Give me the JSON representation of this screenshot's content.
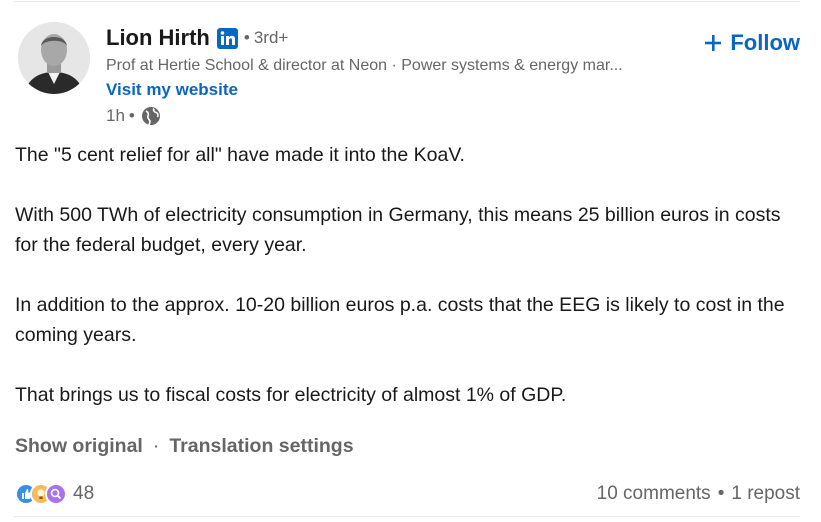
{
  "author": {
    "name": "Lion Hirth",
    "badge_icon": "linkedin-icon",
    "degree_separator": "•",
    "degree": "3rd+",
    "headline": "Prof at Hertie School & director at Neon · Power systems & energy mar...",
    "website_label": "Visit my website",
    "time": "1h",
    "time_separator": "•",
    "visibility_icon": "globe-icon"
  },
  "follow": {
    "label": "Follow",
    "icon": "plus-icon"
  },
  "post": {
    "paragraphs": [
      "The \"5 cent relief for all\" have made it into the KoaV.",
      "With 500 TWh of electricity consumption in Germany, this means 25 billion euros in costs for the federal budget, every year.",
      "In addition to the approx. 10-20 billion euros p.a. costs that the EEG is likely to cost in the coming years.",
      "That brings us to fiscal costs for electricity of almost 1% of GDP."
    ]
  },
  "translation": {
    "show_original": "Show original",
    "separator": "·",
    "settings": "Translation settings"
  },
  "social": {
    "reaction_icons": [
      "like-icon",
      "insightful-icon",
      "curious-icon"
    ],
    "reaction_count": "48",
    "comments": "10 comments",
    "separator": "•",
    "reposts": "1 repost"
  },
  "colors": {
    "link_blue": "#0a66c2",
    "text_primary": "#191919",
    "text_secondary": "#666666"
  }
}
